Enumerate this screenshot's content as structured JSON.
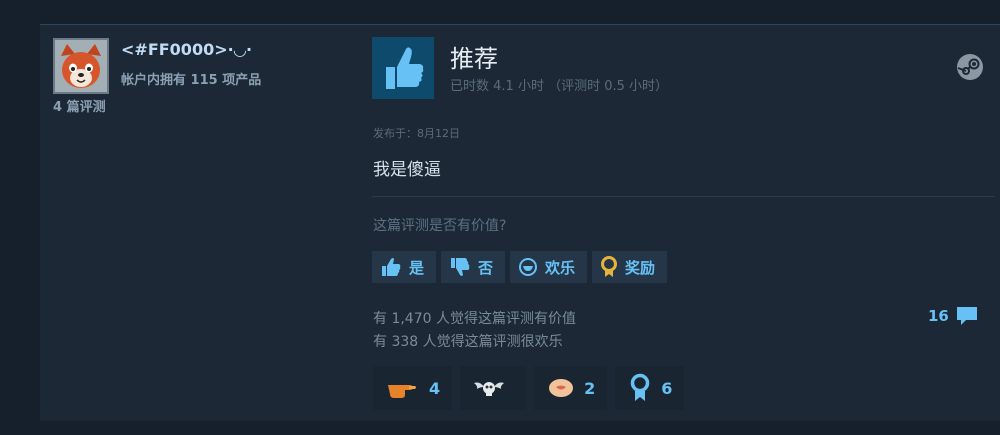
{
  "author": {
    "name": "<#FF0000>·◡·",
    "products_owned": "帐户内拥有 115 项产品",
    "reviews_count": "4 篇评测"
  },
  "review": {
    "verdict": "推荐",
    "hours": "已时数 4.1 小时 （评测时 0.5 小时）",
    "posted": "发布于：8月12日",
    "text": "我是傻逼"
  },
  "helpful": {
    "question": "这篇评测是否有价值?",
    "buttons": [
      {
        "label": "是",
        "icon": "thumb-up-icon"
      },
      {
        "label": "否",
        "icon": "thumb-down-icon"
      },
      {
        "label": "欢乐",
        "icon": "smile-icon"
      },
      {
        "label": "奖励",
        "icon": "award-ribbon-icon"
      }
    ]
  },
  "stats": {
    "helpful_line": "有 1,470 人觉得这篇评测有价值",
    "funny_line": "有 338 人觉得这篇评测很欢乐"
  },
  "comments": {
    "count": "16",
    "icon": "comment-bubble-icon"
  },
  "awards": [
    {
      "icon": "hand-point-icon",
      "count": "4"
    },
    {
      "icon": "winged-skull-icon",
      "count": ""
    },
    {
      "icon": "heart-bubble-icon",
      "count": "2"
    },
    {
      "icon": "medal-icon",
      "count": "6"
    }
  ],
  "colors": {
    "background": "#16202d",
    "card": "#1c2836",
    "accent": "#67c1f5",
    "thumb_box": "#0d4a6b"
  }
}
